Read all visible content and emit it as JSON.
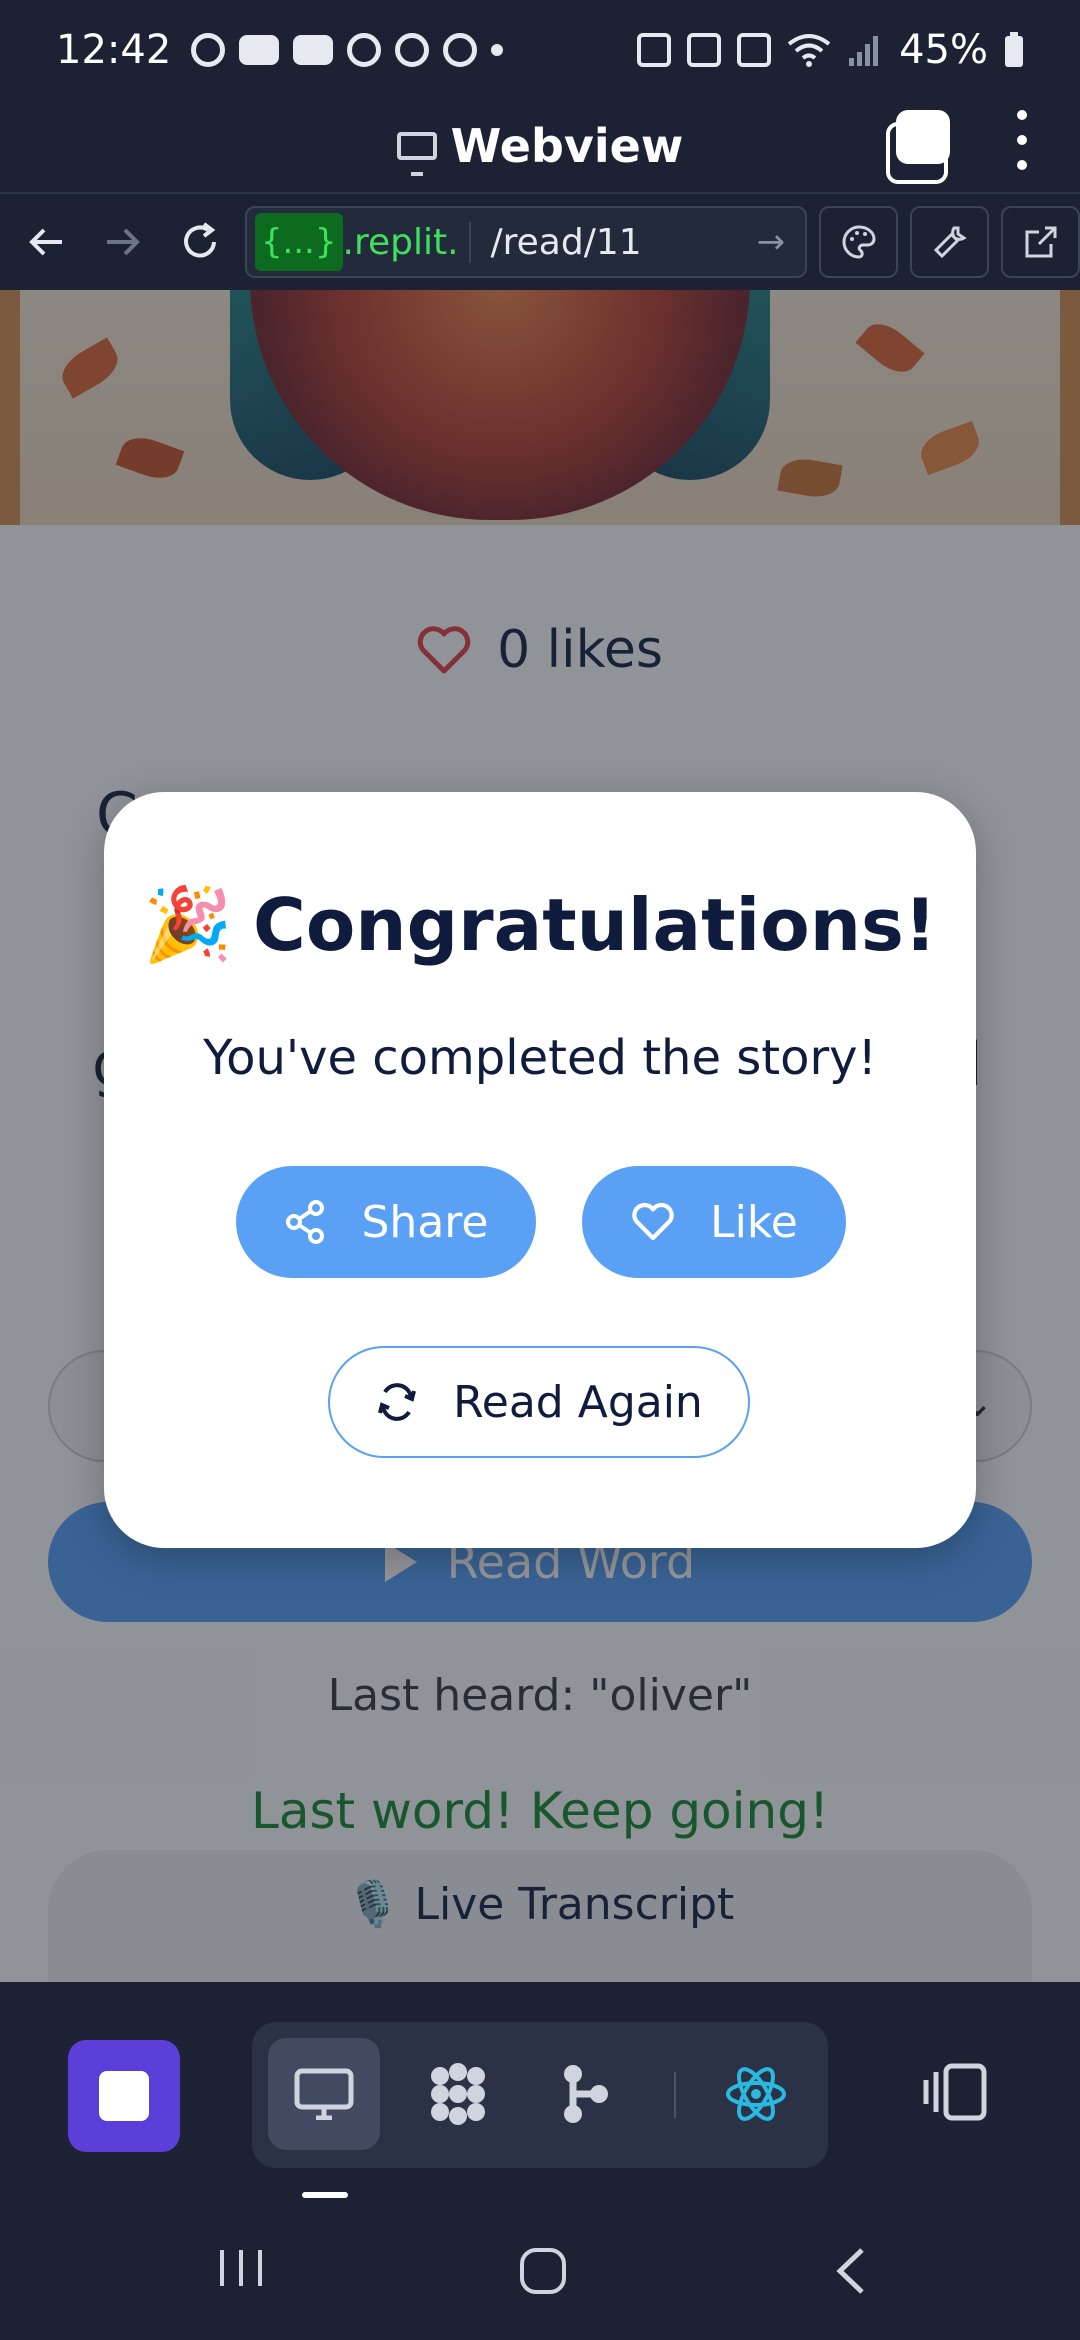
{
  "status_bar": {
    "time": "12:42",
    "battery": "45%",
    "notification_icons": [
      "chrome-icon",
      "youtube-icon",
      "youtube-icon",
      "brain-icon",
      "gmail-icon",
      "chrome-icon",
      "dot-icon"
    ],
    "system_icons": [
      "battery-saver-icon",
      "sleep-icon",
      "mute-icon",
      "wifi-icon",
      "signal-icon",
      "battery-icon"
    ]
  },
  "webview": {
    "title": "Webview"
  },
  "url_bar": {
    "domain_tag": "{...}",
    "domain_rest": ".replit.",
    "path": "/read/11"
  },
  "page": {
    "likes_text": "0 likes",
    "fragment_left_1": "C",
    "fragment_right_1": ",",
    "fragment_left_2": "g",
    "fragment_right_2": "l",
    "read_word_label": "Read Word",
    "last_heard": "Last heard: \"oliver\"",
    "encouragement": "Last word! Keep going!",
    "transcript_title": "🎙️ Live Transcript"
  },
  "modal": {
    "emoji": "🎉",
    "title": "Congratulations!",
    "subtitle": "You've completed the story!",
    "share_label": "Share",
    "like_label": "Like",
    "read_again_label": "Read Again"
  },
  "colors": {
    "accent_blue": "#5aa1f5",
    "stop_purple": "#5b3fd8",
    "success_green": "#1d8a3a",
    "heart_red": "#e0474c",
    "toolbar_bg": "#1c2233"
  }
}
